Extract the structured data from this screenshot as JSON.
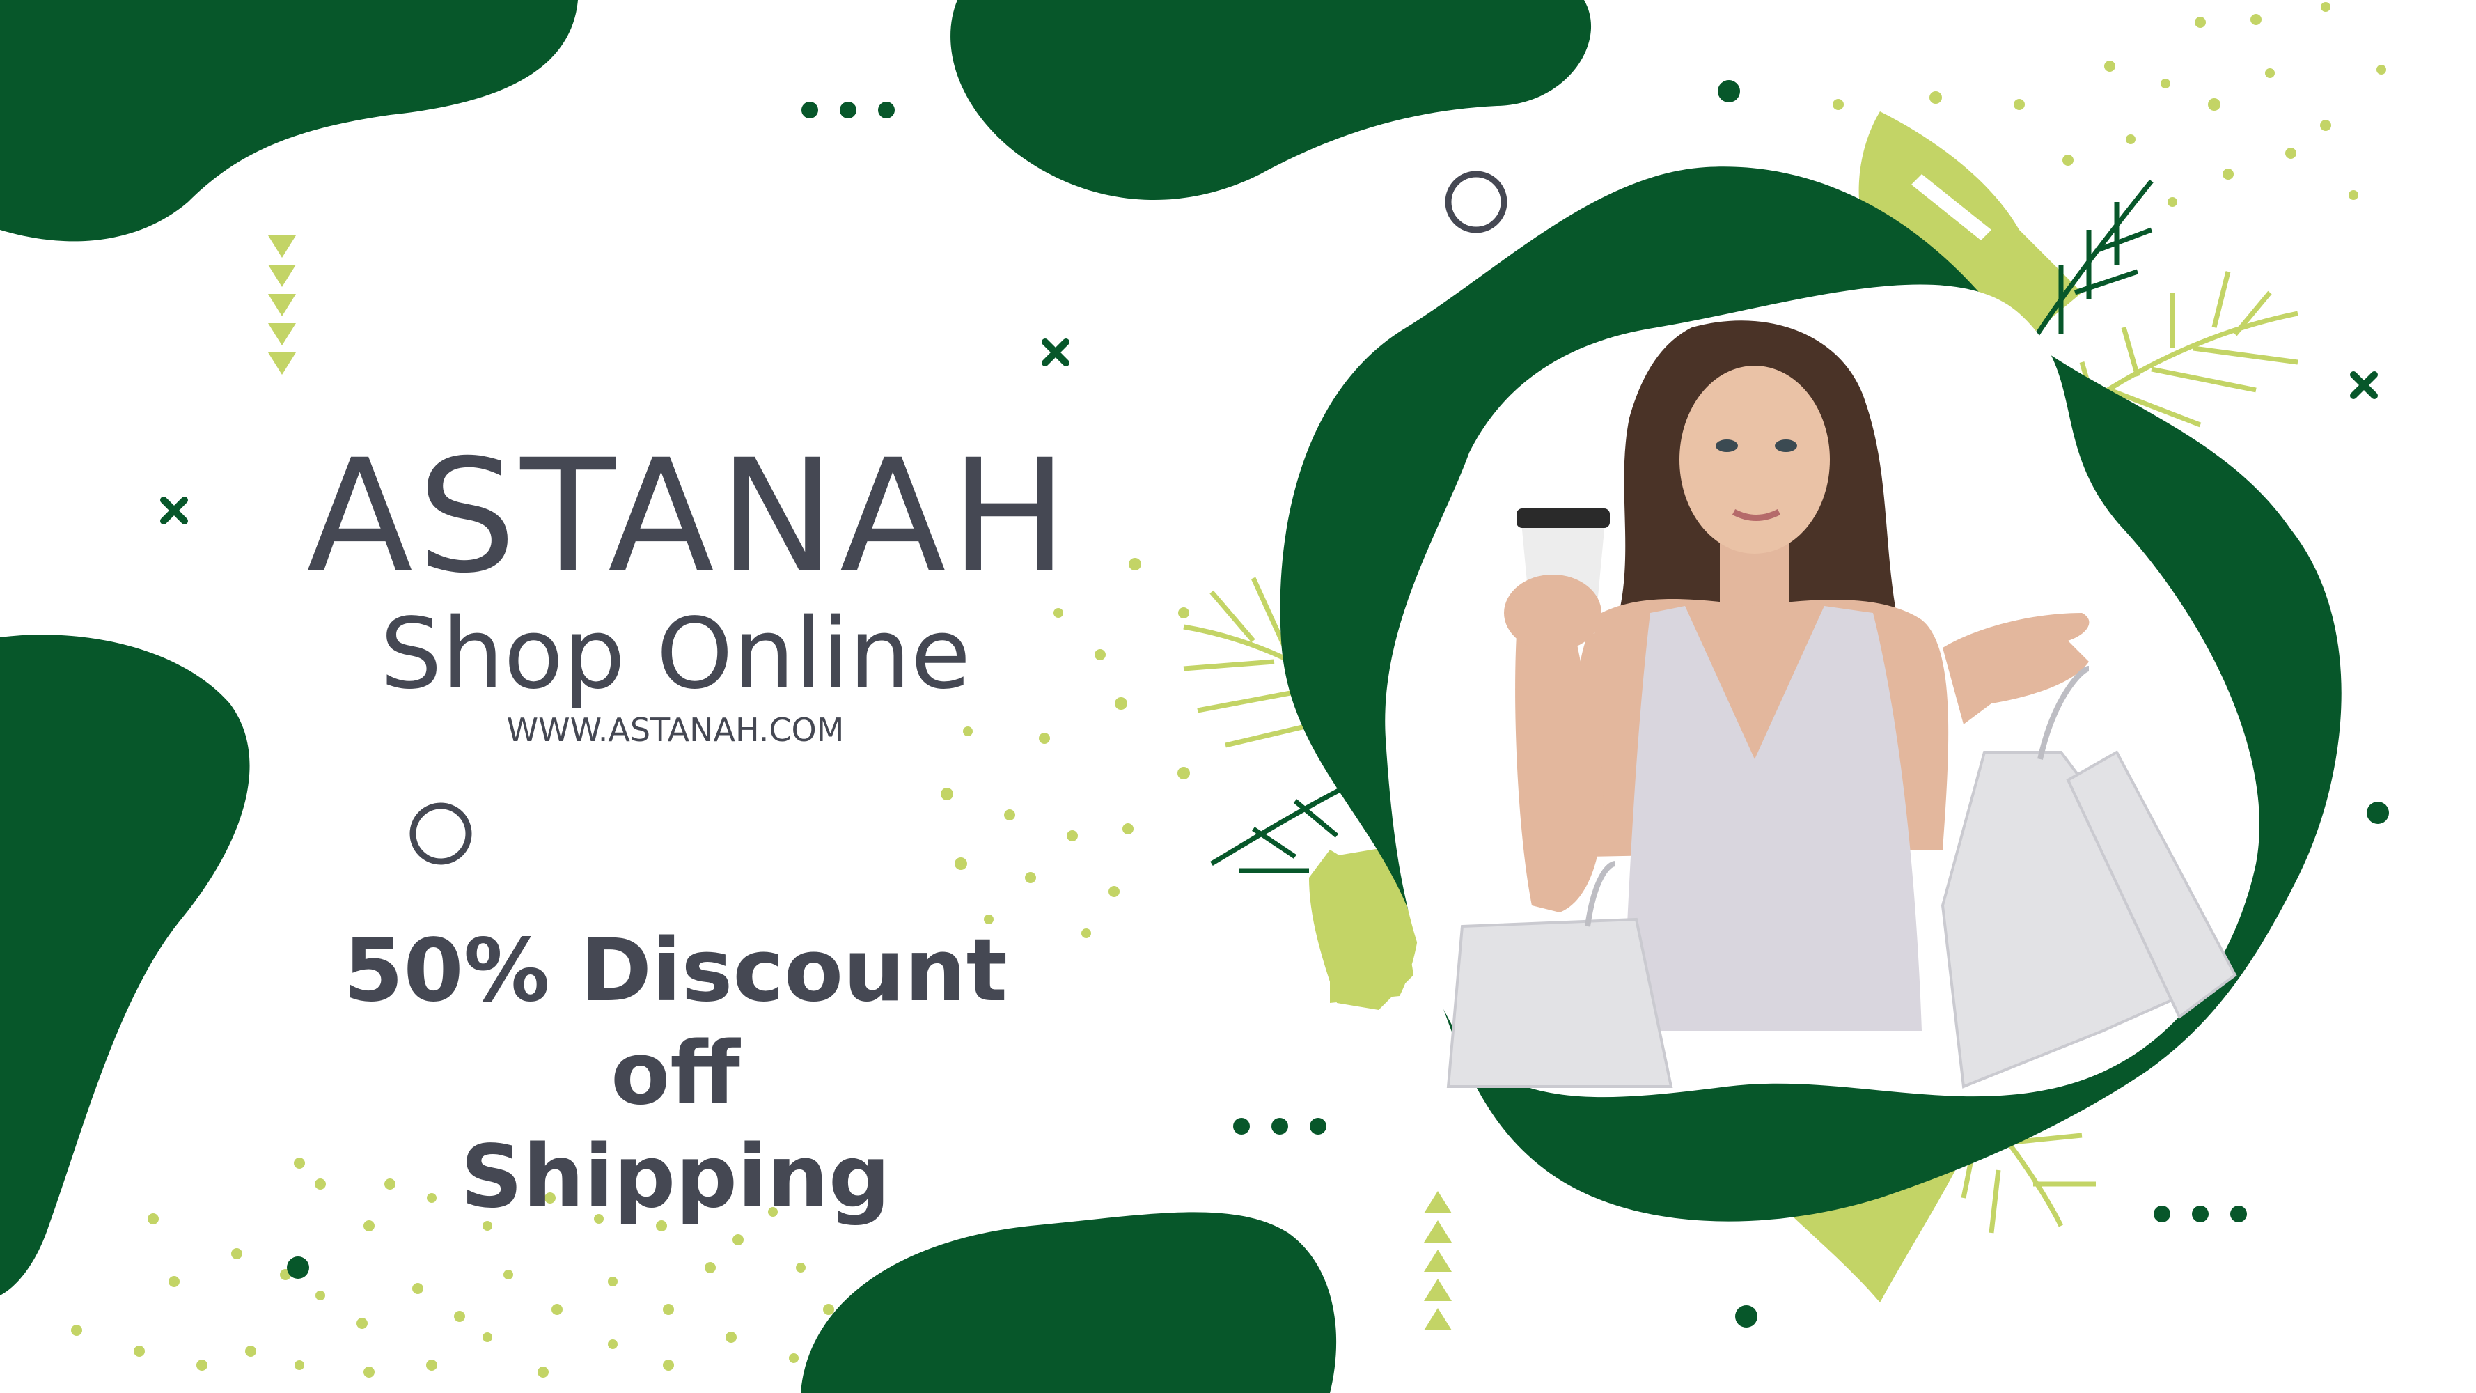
{
  "brand": {
    "title": "ASTANAH",
    "subtitle": "Shop Online",
    "url": "WWW.ASTANAH.COM"
  },
  "promo": {
    "line1": "50% Discount off",
    "line2": "Shipping"
  },
  "colors": {
    "dark_green": "#07572A",
    "lime": "#C3D466",
    "text": "#454853",
    "background": "#FFFFFF"
  },
  "icons": [
    "cross-icon",
    "ring-icon",
    "dot-icon",
    "triangle-icon",
    "leaf-icon",
    "palm-frond-icon"
  ]
}
